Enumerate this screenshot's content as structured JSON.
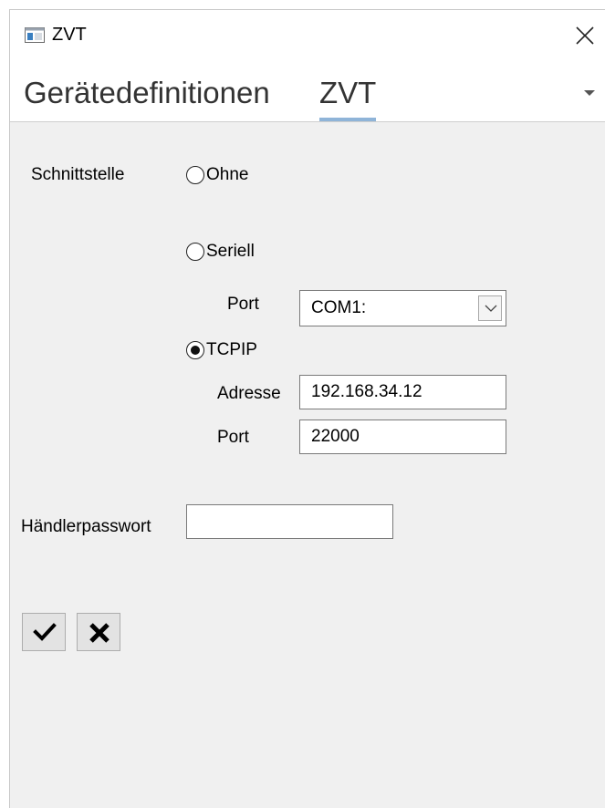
{
  "window": {
    "title": "ZVT",
    "app_icon": "window-app-icon",
    "close_icon": "close-icon"
  },
  "tabs": {
    "heading": "Gerätedefinitionen",
    "active": "ZVT",
    "menu_icon": "caret-down-icon"
  },
  "form": {
    "interface_label": "Schnittstelle",
    "options": {
      "none": {
        "label": "Ohne",
        "selected": false
      },
      "serial": {
        "label": "Seriell",
        "selected": false
      },
      "tcpip": {
        "label": "TCPIP",
        "selected": true
      }
    },
    "serial_port_label": "Port",
    "serial_port_value": "COM1:",
    "address_label": "Adresse",
    "address_value": "192.168.34.12",
    "tcp_port_label": "Port",
    "tcp_port_value": "22000",
    "merchant_password_label": "Händlerpasswort",
    "merchant_password_value": ""
  },
  "buttons": {
    "confirm_icon": "checkmark-icon",
    "cancel_icon": "x-icon"
  },
  "colors": {
    "tab_underline": "#8fb4d8",
    "window_bg": "#f0f0f0",
    "titlebar_bg": "#ffffff"
  }
}
